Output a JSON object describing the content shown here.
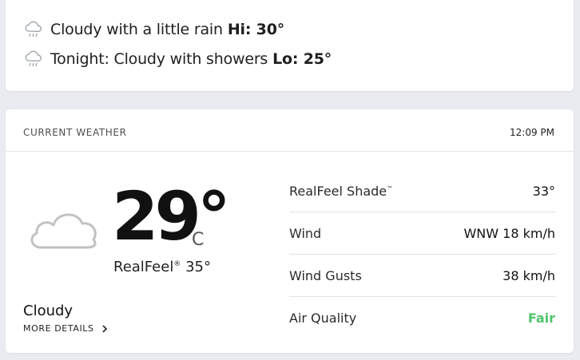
{
  "forecast": {
    "day": {
      "text": "Cloudy with a little rain",
      "hi_label": "Hi: 30°",
      "icon": "rain-cloud-icon"
    },
    "night": {
      "text": "Tonight: Cloudy with showers",
      "lo_label": "Lo: 25°",
      "icon": "rain-cloud-icon"
    }
  },
  "current": {
    "title": "CURRENT WEATHER",
    "time": "12:09 PM",
    "icon": "cloud-icon",
    "temperature": "29°",
    "unit": "C",
    "realfeel_label": "RealFeel",
    "realfeel_mark": "®",
    "realfeel_value": "35°",
    "condition": "Cloudy",
    "more_details": "MORE DETAILS"
  },
  "details": {
    "realfeel_shade": {
      "label": "RealFeel Shade",
      "mark": "™",
      "value": "33°"
    },
    "wind": {
      "label": "Wind",
      "value": "WNW 18 km/h"
    },
    "wind_gusts": {
      "label": "Wind Gusts",
      "value": "38 km/h"
    },
    "air_quality": {
      "label": "Air Quality",
      "value": "Fair",
      "color": "#4fc36b"
    }
  }
}
